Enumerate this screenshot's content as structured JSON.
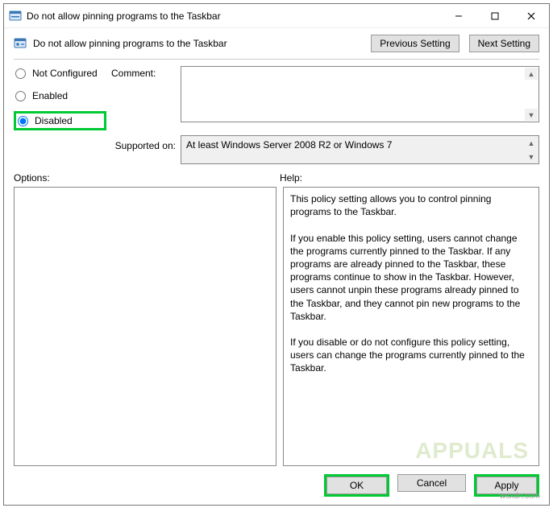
{
  "titlebar": {
    "title": "Do not allow pinning programs to the Taskbar"
  },
  "header": {
    "policy_title": "Do not allow pinning programs to the Taskbar",
    "previous": "Previous Setting",
    "next": "Next Setting"
  },
  "radios": {
    "not_configured": "Not Configured",
    "enabled": "Enabled",
    "disabled": "Disabled"
  },
  "labels": {
    "comment": "Comment:",
    "supported": "Supported on:",
    "options": "Options:",
    "help": "Help:"
  },
  "supported_text": "At least Windows Server 2008 R2 or Windows 7",
  "help_text": {
    "p1": "This policy setting allows you to control pinning programs to the Taskbar.",
    "p2": "If you enable this policy setting, users cannot change the programs currently pinned to the Taskbar. If any programs are already pinned to the Taskbar, these programs continue to show in the Taskbar. However, users cannot unpin these programs already pinned to the Taskbar, and they cannot pin new programs to the Taskbar.",
    "p3": "If you disable or do not configure this policy setting, users can change the programs currently pinned to the Taskbar."
  },
  "buttons": {
    "ok": "OK",
    "cancel": "Cancel",
    "apply": "Apply"
  },
  "watermark": "APPUALS",
  "site": "wsxdn.com"
}
